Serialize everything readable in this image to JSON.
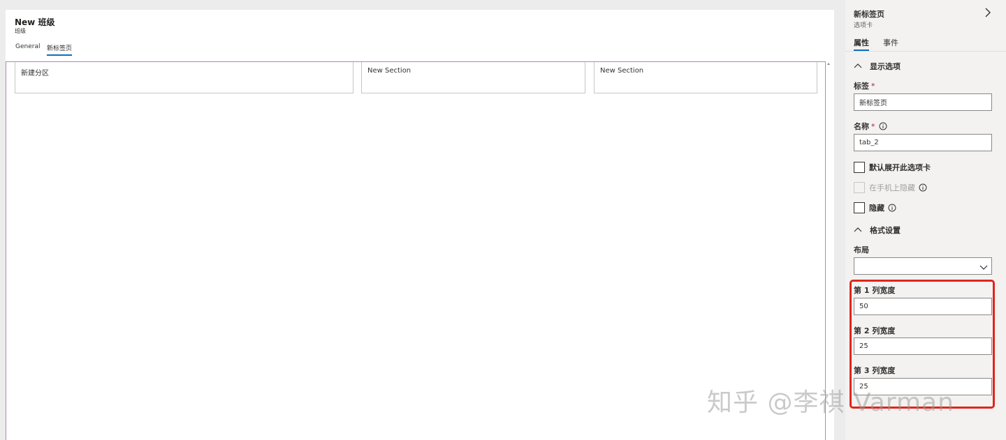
{
  "form": {
    "title": "New 班级",
    "subtitle": "班级",
    "tabs": [
      {
        "label": "General",
        "active": false
      },
      {
        "label": "新标签页",
        "active": true
      }
    ],
    "sections": [
      {
        "label": "新建分区"
      },
      {
        "label": "New Section"
      },
      {
        "label": "New Section"
      }
    ]
  },
  "panel": {
    "title": "新标签页",
    "subtitle": "选项卡",
    "tabs": [
      {
        "label": "属性",
        "active": true
      },
      {
        "label": "事件",
        "active": false
      }
    ],
    "display_group": {
      "title": "显示选项",
      "label_field": {
        "label": "标签",
        "required_mark": "*",
        "value": "新标签页"
      },
      "name_field": {
        "label": "名称",
        "required_mark": "*",
        "value": "tab_2"
      },
      "checkboxes": [
        {
          "label": "默认展开此选项卡",
          "checked": false,
          "disabled": false
        },
        {
          "label": "在手机上隐藏",
          "checked": false,
          "disabled": true
        },
        {
          "label": "隐藏",
          "checked": false,
          "disabled": false
        }
      ]
    },
    "format_group": {
      "title": "格式设置",
      "layout_label": "布局",
      "layout_value": "",
      "column_widths": [
        {
          "label": "第 1 列宽度",
          "value": "50"
        },
        {
          "label": "第 2 列宽度",
          "value": "25"
        },
        {
          "label": "第 3 列宽度",
          "value": "25"
        }
      ]
    }
  },
  "watermark": "知乎 @李祺 Varman",
  "colors": {
    "accent": "#0f6cbd",
    "highlight": "#e1251b",
    "tab_body_border": "#a88bb6",
    "required": "#a4262c"
  }
}
